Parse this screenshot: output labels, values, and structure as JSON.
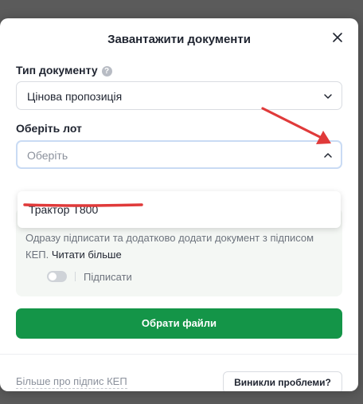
{
  "modal": {
    "title": "Завантажити документи"
  },
  "doc_type": {
    "label": "Тип документу",
    "help_glyph": "?",
    "value": "Цінова пропозиція"
  },
  "lot": {
    "label": "Оберіть лот",
    "placeholder": "Оберіть",
    "options": [
      "Трактор Т800"
    ]
  },
  "sign_info": {
    "text": "Одразу підписати та додатково додати документ з підписом КЕП.",
    "link": "Читати більше",
    "toggle_label": "Підписати",
    "toggle_on": false
  },
  "actions": {
    "choose_files": "Обрати файли",
    "kep_link": "Більше про підпис КЕП",
    "problems": "Виникли проблеми?"
  },
  "colors": {
    "primary": "#149548",
    "annotation": "#e03a3a",
    "focus_border": "#c9dbf4"
  },
  "icons": {
    "close": "close-icon",
    "help": "question-circle-icon",
    "chevron_down": "chevron-down-icon",
    "chevron_up": "chevron-up-icon",
    "annotation_arrow": "red-arrow-annotation",
    "annotation_underline": "red-underline-annotation"
  }
}
